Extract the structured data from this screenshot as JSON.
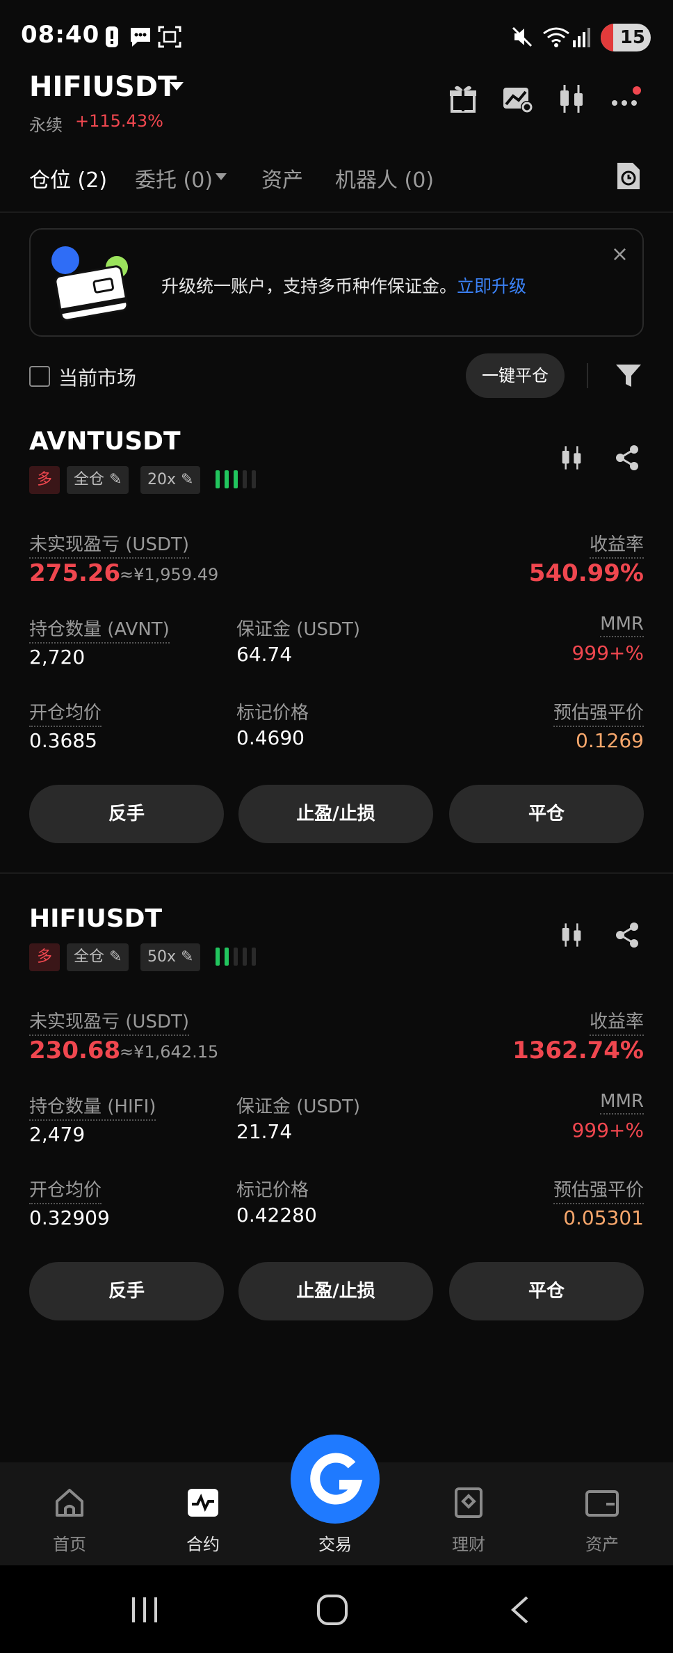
{
  "status_bar": {
    "time": "08:40",
    "battery": "15"
  },
  "header": {
    "pair": "HIFIUSDT",
    "contract_type": "永续",
    "change": "+115.43%",
    "icons": [
      "gift-icon",
      "chart-settings-icon",
      "candlestick-icon",
      "more-icon"
    ]
  },
  "tabs": [
    {
      "label": "仓位 (2)"
    },
    {
      "label": "委托 (0)"
    },
    {
      "label": "资产"
    },
    {
      "label": "机器人 (0)"
    }
  ],
  "banner": {
    "text": "升级统一账户，支持多币种作保证金。",
    "link": "立即升级",
    "close": "×"
  },
  "filter": {
    "current_market": "当前市场",
    "close_all": "一键平仓"
  },
  "positions": [
    {
      "symbol": "AVNTUSDT",
      "side": "多",
      "margin_mode": "全仓",
      "leverage": "20x",
      "risk_level": 3,
      "pnl_label": "未实现盈亏 (USDT)",
      "pnl": "275.26",
      "pnl_cny": "≈¥1,959.49",
      "roe_label": "收益率",
      "roe": "540.99%",
      "size_label": "持仓数量 (AVNT)",
      "size": "2,720",
      "margin_label": "保证金 (USDT)",
      "margin": "64.74",
      "mmr_label": "MMR",
      "mmr": "999+%",
      "entry_label": "开仓均价",
      "entry": "0.3685",
      "mark_label": "标记价格",
      "mark": "0.4690",
      "liq_label": "预估强平价",
      "liq": "0.1269",
      "btn_reverse": "反手",
      "btn_tpsl": "止盈/止损",
      "btn_close": "平仓"
    },
    {
      "symbol": "HIFIUSDT",
      "side": "多",
      "margin_mode": "全仓",
      "leverage": "50x",
      "risk_level": 2,
      "pnl_label": "未实现盈亏 (USDT)",
      "pnl": "230.68",
      "pnl_cny": "≈¥1,642.15",
      "roe_label": "收益率",
      "roe": "1362.74%",
      "size_label": "持仓数量 (HIFI)",
      "size": "2,479",
      "margin_label": "保证金 (USDT)",
      "margin": "21.74",
      "mmr_label": "MMR",
      "mmr": "999+%",
      "entry_label": "开仓均价",
      "entry": "0.32909",
      "mark_label": "标记价格",
      "mark": "0.42280",
      "liq_label": "预估强平价",
      "liq": "0.05301",
      "btn_reverse": "反手",
      "btn_tpsl": "止盈/止损",
      "btn_close": "平仓"
    }
  ],
  "bottom_nav": [
    {
      "label": "首页",
      "icon": "home-icon"
    },
    {
      "label": "合约",
      "icon": "futures-icon"
    },
    {
      "label": "交易",
      "icon": "trade-icon"
    },
    {
      "label": "理财",
      "icon": "earn-icon"
    },
    {
      "label": "资产",
      "icon": "wallet-icon"
    }
  ],
  "colors": {
    "up": "#f0474f",
    "accent": "#1f7aff",
    "liq": "#f7a76c",
    "risk": "#22c55e"
  }
}
